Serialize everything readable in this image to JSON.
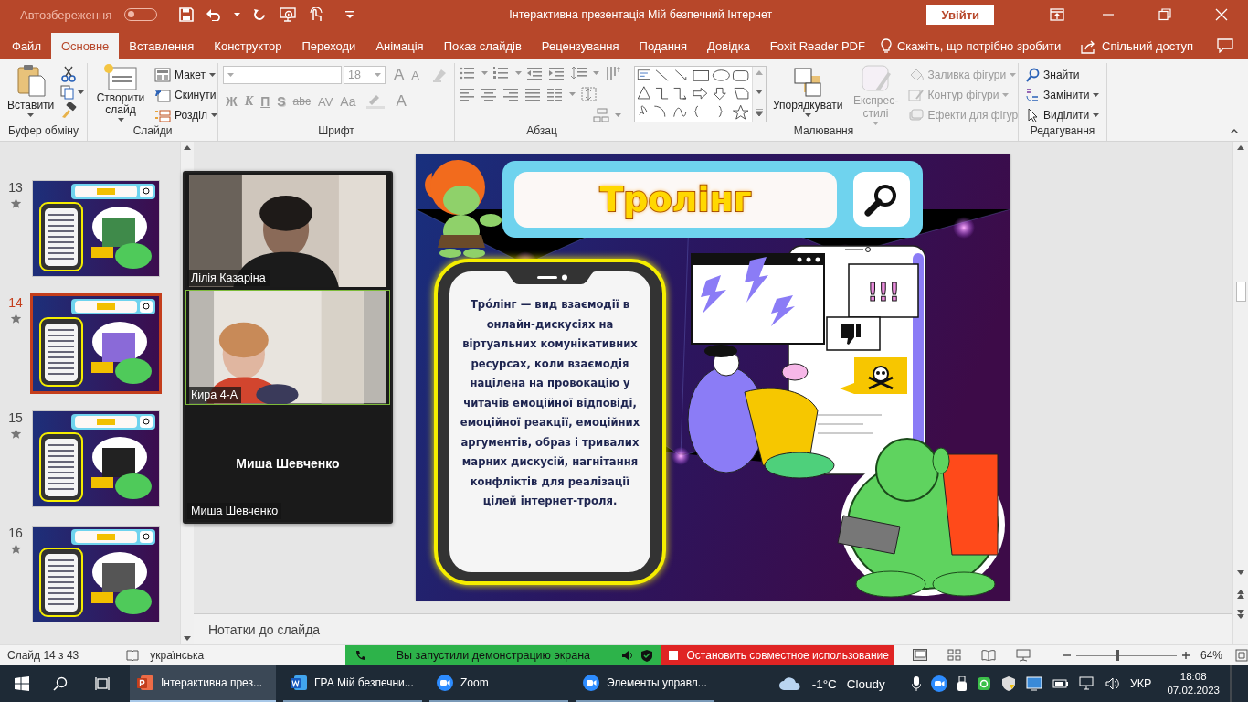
{
  "title_bar": {
    "autosave_label": "Автозбереження",
    "autosave_on": false,
    "title": "Інтерактивна презентація Мій безпечний Інтернет",
    "sign_in": "Увійти"
  },
  "tabs": [
    {
      "label": "Файл",
      "selected": false
    },
    {
      "label": "Основне",
      "selected": true
    },
    {
      "label": "Вставлення",
      "selected": false
    },
    {
      "label": "Конструктор",
      "selected": false
    },
    {
      "label": "Переходи",
      "selected": false
    },
    {
      "label": "Анімація",
      "selected": false
    },
    {
      "label": "Показ слайдів",
      "selected": false
    },
    {
      "label": "Рецензування",
      "selected": false
    },
    {
      "label": "Подання",
      "selected": false
    },
    {
      "label": "Довідка",
      "selected": false
    },
    {
      "label": "Foxit Reader PDF",
      "selected": false
    }
  ],
  "tell_me": "Скажіть, що потрібно зробити",
  "share": "Спільний доступ",
  "clipboard": {
    "label": "Буфер обміну",
    "paste": "Вставити"
  },
  "slides_group": {
    "label": "Слайди",
    "new_slide": "Створити слайд",
    "commands": [
      {
        "kind": "layout",
        "label": "Макет",
        "dropdown": true
      },
      {
        "kind": "reset",
        "label": "Скинути",
        "dropdown": false
      },
      {
        "kind": "section",
        "label": "Розділ",
        "dropdown": true
      }
    ]
  },
  "font": {
    "label": "Шрифт",
    "size": "18",
    "disabled": true,
    "grow_label": "A",
    "shrink_label": "A",
    "color_label": "A",
    "buttons": [
      {
        "kind": "bold",
        "label": "Ж"
      },
      {
        "kind": "italic",
        "label": "К"
      },
      {
        "kind": "underline",
        "label": "П"
      },
      {
        "kind": "shadow",
        "label": "S"
      },
      {
        "kind": "strike",
        "label": "abc"
      },
      {
        "kind": "spacing",
        "label": "AV"
      },
      {
        "kind": "case",
        "label": "Aa"
      }
    ]
  },
  "paragraph": {
    "label": "Абзац"
  },
  "drawing": {
    "label": "Малювання",
    "arrange": "Упорядкувати",
    "quick_styles": {
      "label": "Експрес-стилі",
      "disabled": true
    },
    "commands": [
      {
        "kind": "fill",
        "label": "Заливка фігури",
        "disabled": true
      },
      {
        "kind": "outline",
        "label": "Контур фігури",
        "disabled": true
      },
      {
        "kind": "effects",
        "label": "Ефекти для фігур",
        "disabled": true
      }
    ]
  },
  "editing": {
    "label": "Редагування",
    "commands": [
      {
        "kind": "find",
        "label": "Знайти",
        "dropdown": false
      },
      {
        "kind": "replace",
        "label": "Замінити",
        "dropdown": true
      },
      {
        "kind": "select",
        "label": "Виділити",
        "dropdown": true
      }
    ]
  },
  "thumbnails": [
    {
      "number": "13",
      "selected": false
    },
    {
      "number": "14",
      "selected": true
    },
    {
      "number": "15",
      "selected": false
    },
    {
      "number": "16",
      "selected": false
    }
  ],
  "video": {
    "participants": [
      {
        "kind": "video",
        "name": "Лілія Казаріна",
        "active_speaker": false
      },
      {
        "kind": "video",
        "name": "Кира 4-А",
        "active_speaker": true
      },
      {
        "kind": "avatar",
        "name": "Миша Шевченко",
        "display_name": "Миша Шевченко",
        "active_speaker": false
      }
    ]
  },
  "slide": {
    "title": "Тролінг",
    "definition": "Тро́лінг — вид взаємодії в онлайн-дискусіях на віртуальних комунікативних ресурсах, коли взаємодія націлена на провокацію у читачів емоційної відповіді, емоційної реакції, емоційних аргументів, образ і тривалих марних дискусій, нагнітання конфліктів для реалізації цілей інтернет-троля.",
    "bubble_text": "!!!"
  },
  "notes_placeholder": "Нотатки до слайда",
  "status_bar": {
    "slide_counter": "Слайд 14 з 43",
    "language": "українська",
    "zoom": "64%",
    "zoom_slider": {
      "level": 0.41
    }
  },
  "screen_share": {
    "status": "Вы запустили демонстрацию экрана",
    "stop": "Остановить совместное использование"
  },
  "taskbar": {
    "apps": [
      {
        "kind": "powerpoint",
        "label": "Інтерактивна през...",
        "selected": true
      },
      {
        "kind": "word",
        "label": "ГРА Мій безпечни...",
        "selected": false
      },
      {
        "kind": "zoom",
        "label": "Zoom",
        "selected": false
      },
      {
        "kind": "zoom",
        "label": "Элементы управл...",
        "selected": false
      }
    ],
    "weather": {
      "temperature": "-1°C",
      "condition": "Cloudy"
    },
    "language": "УКР",
    "time": "18:08",
    "date": "07.02.2023"
  }
}
